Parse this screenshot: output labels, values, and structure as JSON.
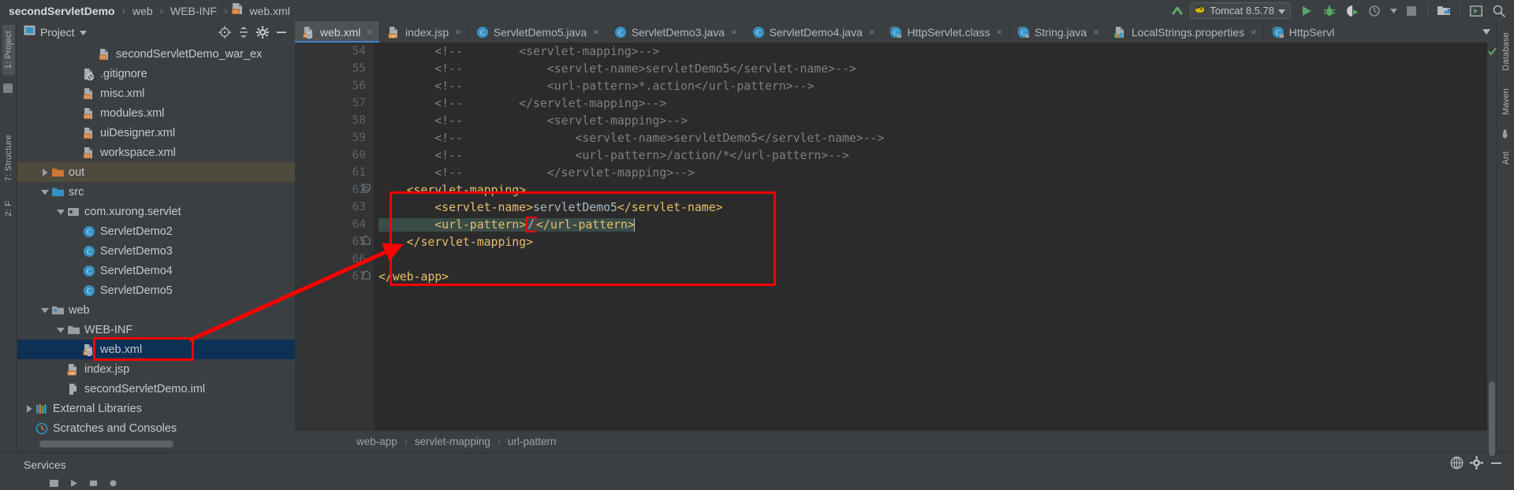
{
  "window": {
    "breadcrumbs": [
      {
        "label": "secondServletDemo",
        "bold": true,
        "icon": null
      },
      {
        "label": "web",
        "bold": false,
        "icon": null
      },
      {
        "label": "WEB-INF",
        "bold": false,
        "icon": null
      },
      {
        "label": "web.xml",
        "bold": false,
        "icon": "xml-file-icon"
      }
    ]
  },
  "toolbar": {
    "run_config": {
      "label": "Tomcat 8.5.78",
      "icon": "tomcat-icon",
      "dropdown_icon": "chevron-down-icon"
    },
    "buttons": [
      {
        "name": "update-application-icon",
        "glyph": "update-arrow"
      },
      {
        "name": "run-button",
        "glyph": "play"
      },
      {
        "name": "debug-button",
        "glyph": "bug"
      },
      {
        "name": "run-with-coverage-button",
        "glyph": "coverage"
      },
      {
        "name": "profiler-button",
        "glyph": "profiler"
      },
      {
        "name": "profiler-dropdown",
        "glyph": "chevron-down"
      },
      {
        "name": "stop-button",
        "glyph": "square"
      },
      {
        "name": "deploy-button",
        "glyph": "deploy"
      },
      {
        "name": "run-anything-button",
        "glyph": "terminal"
      },
      {
        "name": "search-everywhere-button",
        "glyph": "magnifier"
      }
    ]
  },
  "left_rail": {
    "tabs": [
      {
        "label": "1: Project",
        "name": "rail-tab-project",
        "active": true
      },
      {
        "label": "7: Structure",
        "name": "rail-tab-structure",
        "active": false
      },
      {
        "label": "2: F",
        "name": "rail-tab-favorites",
        "active": false
      }
    ]
  },
  "right_rail": {
    "tabs": [
      {
        "label": "Database",
        "name": "rail-tab-database"
      },
      {
        "label": "Maven",
        "name": "rail-tab-maven"
      },
      {
        "label": "Ant",
        "name": "rail-tab-ant"
      }
    ]
  },
  "project_panel": {
    "title": "Project",
    "title_dropdown_icon": "chevron-down-icon",
    "header_buttons": [
      {
        "name": "locate-file-button",
        "glyph": "crosshair"
      },
      {
        "name": "collapse-all-button",
        "glyph": "collapse"
      },
      {
        "name": "settings-button",
        "glyph": "gear"
      },
      {
        "name": "hide-panel-button",
        "glyph": "minus"
      }
    ],
    "tree": [
      {
        "label": "secondServletDemo_war_ex",
        "indent": 4,
        "arrow": "none",
        "icon": "xml-file-icon",
        "state": "none"
      },
      {
        "label": ".gitignore",
        "indent": 3,
        "arrow": "none",
        "icon": "gitignore-file-icon",
        "state": "none"
      },
      {
        "label": "misc.xml",
        "indent": 3,
        "arrow": "none",
        "icon": "xml-file-icon",
        "state": "none"
      },
      {
        "label": "modules.xml",
        "indent": 3,
        "arrow": "none",
        "icon": "xml-file-icon",
        "state": "none"
      },
      {
        "label": "uiDesigner.xml",
        "indent": 3,
        "arrow": "none",
        "icon": "xml-file-icon",
        "state": "none"
      },
      {
        "label": "workspace.xml",
        "indent": 3,
        "arrow": "none",
        "icon": "xml-file-icon",
        "state": "none"
      },
      {
        "label": "out",
        "indent": 1,
        "arrow": "collapsed",
        "icon": "folder-orange-icon",
        "state": "highlight-olive"
      },
      {
        "label": "src",
        "indent": 1,
        "arrow": "expanded",
        "icon": "folder-blue-icon",
        "state": "none"
      },
      {
        "label": "com.xurong.servlet",
        "indent": 2,
        "arrow": "expanded",
        "icon": "package-icon",
        "state": "none"
      },
      {
        "label": "ServletDemo2",
        "indent": 3,
        "arrow": "none",
        "icon": "java-class-icon",
        "state": "none"
      },
      {
        "label": "ServletDemo3",
        "indent": 3,
        "arrow": "none",
        "icon": "java-class-icon",
        "state": "none"
      },
      {
        "label": "ServletDemo4",
        "indent": 3,
        "arrow": "none",
        "icon": "java-class-icon",
        "state": "none"
      },
      {
        "label": "ServletDemo5",
        "indent": 3,
        "arrow": "none",
        "icon": "java-class-icon",
        "state": "none"
      },
      {
        "label": "web",
        "indent": 1,
        "arrow": "expanded",
        "icon": "folder-web-icon",
        "state": "none"
      },
      {
        "label": "WEB-INF",
        "indent": 2,
        "arrow": "expanded",
        "icon": "folder-gray-icon",
        "state": "none"
      },
      {
        "label": "web.xml",
        "indent": 3,
        "arrow": "none",
        "icon": "webxml-file-icon",
        "state": "selected-blue"
      },
      {
        "label": "index.jsp",
        "indent": 2,
        "arrow": "none",
        "icon": "jsp-file-icon",
        "state": "none"
      },
      {
        "label": "secondServletDemo.iml",
        "indent": 2,
        "arrow": "none",
        "icon": "iml-file-icon",
        "state": "none"
      },
      {
        "label": "External Libraries",
        "indent": 0,
        "arrow": "collapsed",
        "icon": "libraries-icon",
        "state": "none"
      },
      {
        "label": "Scratches and Consoles",
        "indent": 0,
        "arrow": "none",
        "icon": "scratches-icon",
        "state": "none"
      }
    ]
  },
  "editor": {
    "tabs": [
      {
        "label": "web.xml",
        "icon": "webxml-file-icon",
        "active": true,
        "close_glyph": "×"
      },
      {
        "label": "index.jsp",
        "icon": "jsp-file-icon",
        "active": false,
        "close_glyph": "×"
      },
      {
        "label": "ServletDemo5.java",
        "icon": "java-class-icon",
        "active": false,
        "close_glyph": "×"
      },
      {
        "label": "ServletDemo3.java",
        "icon": "java-class-icon",
        "active": false,
        "close_glyph": "×"
      },
      {
        "label": "ServletDemo4.java",
        "icon": "java-class-icon",
        "active": false,
        "close_glyph": "×"
      },
      {
        "label": "HttpServlet.class",
        "icon": "java-class-library-icon",
        "active": false,
        "close_glyph": "×"
      },
      {
        "label": "String.java",
        "icon": "java-class-library-icon",
        "active": false,
        "close_glyph": "×"
      },
      {
        "label": "LocalStrings.properties",
        "icon": "properties-file-icon",
        "active": false,
        "close_glyph": "×"
      },
      {
        "label": "HttpServl",
        "icon": "java-class-library-icon",
        "active": false,
        "close_glyph": ""
      }
    ],
    "tab_overflow_icon": "chevron-down-icon",
    "first_visible_line": 54,
    "lines": [
      {
        "num": 54,
        "fold": "none",
        "selected": false,
        "segments": [
          {
            "t": "comment",
            "s": "        <!--        <servlet-mapping>-->"
          }
        ]
      },
      {
        "num": 55,
        "fold": "none",
        "selected": false,
        "segments": [
          {
            "t": "comment",
            "s": "        <!--            <servlet-name>servletDemo5</servlet-name>-->"
          }
        ]
      },
      {
        "num": 56,
        "fold": "none",
        "selected": false,
        "segments": [
          {
            "t": "comment",
            "s": "        <!--            <url-pattern>*.action</url-pattern>-->"
          }
        ]
      },
      {
        "num": 57,
        "fold": "none",
        "selected": false,
        "segments": [
          {
            "t": "comment",
            "s": "        <!--        </servlet-mapping>-->"
          }
        ]
      },
      {
        "num": 58,
        "fold": "none",
        "selected": false,
        "segments": [
          {
            "t": "comment",
            "s": "        <!--            <servlet-mapping>-->"
          }
        ]
      },
      {
        "num": 59,
        "fold": "none",
        "selected": false,
        "segments": [
          {
            "t": "comment",
            "s": "        <!--                <servlet-name>servletDemo5</servlet-name>-->"
          }
        ]
      },
      {
        "num": 60,
        "fold": "none",
        "selected": false,
        "segments": [
          {
            "t": "comment",
            "s": "        <!--                <url-pattern>/action/*</url-pattern>-->"
          }
        ]
      },
      {
        "num": 61,
        "fold": "none",
        "selected": false,
        "segments": [
          {
            "t": "comment",
            "s": "        <!--            </servlet-mapping>-->"
          }
        ]
      },
      {
        "num": 62,
        "fold": "start",
        "selected": false,
        "segments": [
          {
            "t": "tag",
            "s": "    <servlet-mapping>"
          }
        ]
      },
      {
        "num": 63,
        "fold": "none",
        "selected": false,
        "segments": [
          {
            "t": "tag",
            "s": "        <servlet-name>"
          },
          {
            "t": "text",
            "s": "servletDemo5"
          },
          {
            "t": "tag",
            "s": "</servlet-name>"
          }
        ]
      },
      {
        "num": 64,
        "fold": "none",
        "selected": true,
        "segments": [
          {
            "t": "tag",
            "s": "        <url-pattern>"
          },
          {
            "t": "boxed",
            "s": "/"
          },
          {
            "t": "tag",
            "s": "</url-pattern>"
          },
          {
            "t": "caret",
            "s": ""
          }
        ]
      },
      {
        "num": 65,
        "fold": "end",
        "selected": false,
        "segments": [
          {
            "t": "tag",
            "s": "    </servlet-mapping>"
          }
        ]
      },
      {
        "num": 66,
        "fold": "none",
        "selected": false,
        "segments": [
          {
            "t": "text",
            "s": ""
          }
        ]
      },
      {
        "num": 67,
        "fold": "end",
        "selected": false,
        "segments": [
          {
            "t": "tag",
            "s": "</web-app>"
          }
        ]
      }
    ],
    "breadcrumb": [
      "web-app",
      "servlet-mapping",
      "url-pattern"
    ],
    "breadcrumb_separator": "›",
    "inspection_status_icon": "checkmark-green-icon"
  },
  "services_panel": {
    "title": "Services",
    "buttons": [
      {
        "name": "services-help-button",
        "glyph": "help"
      },
      {
        "name": "services-settings-button",
        "glyph": "gear"
      },
      {
        "name": "services-hide-button",
        "glyph": "minus"
      }
    ]
  },
  "annotations": {
    "code_box_color": "#ff0000",
    "tree_box_color": "#ff0000",
    "arrow_color": "#ff0000",
    "slash_box_color": "#ff0000"
  },
  "colors": {
    "panel_bg": "#3c3f41",
    "editor_bg": "#2b2b2b",
    "gutter_bg": "#313335",
    "tag_color": "#e8bf6a",
    "text_color": "#a9b7c6",
    "comment_color": "#808080",
    "selection_bg": "#3a4c48",
    "tab_active_bg": "#4e5254",
    "tab_underline": "#3e86c9",
    "tree_selected_bg": "#0d3055",
    "tree_highlight_bg": "#4e4a3c",
    "accent_green": "#59a869",
    "accent_orange": "#cc7832"
  }
}
